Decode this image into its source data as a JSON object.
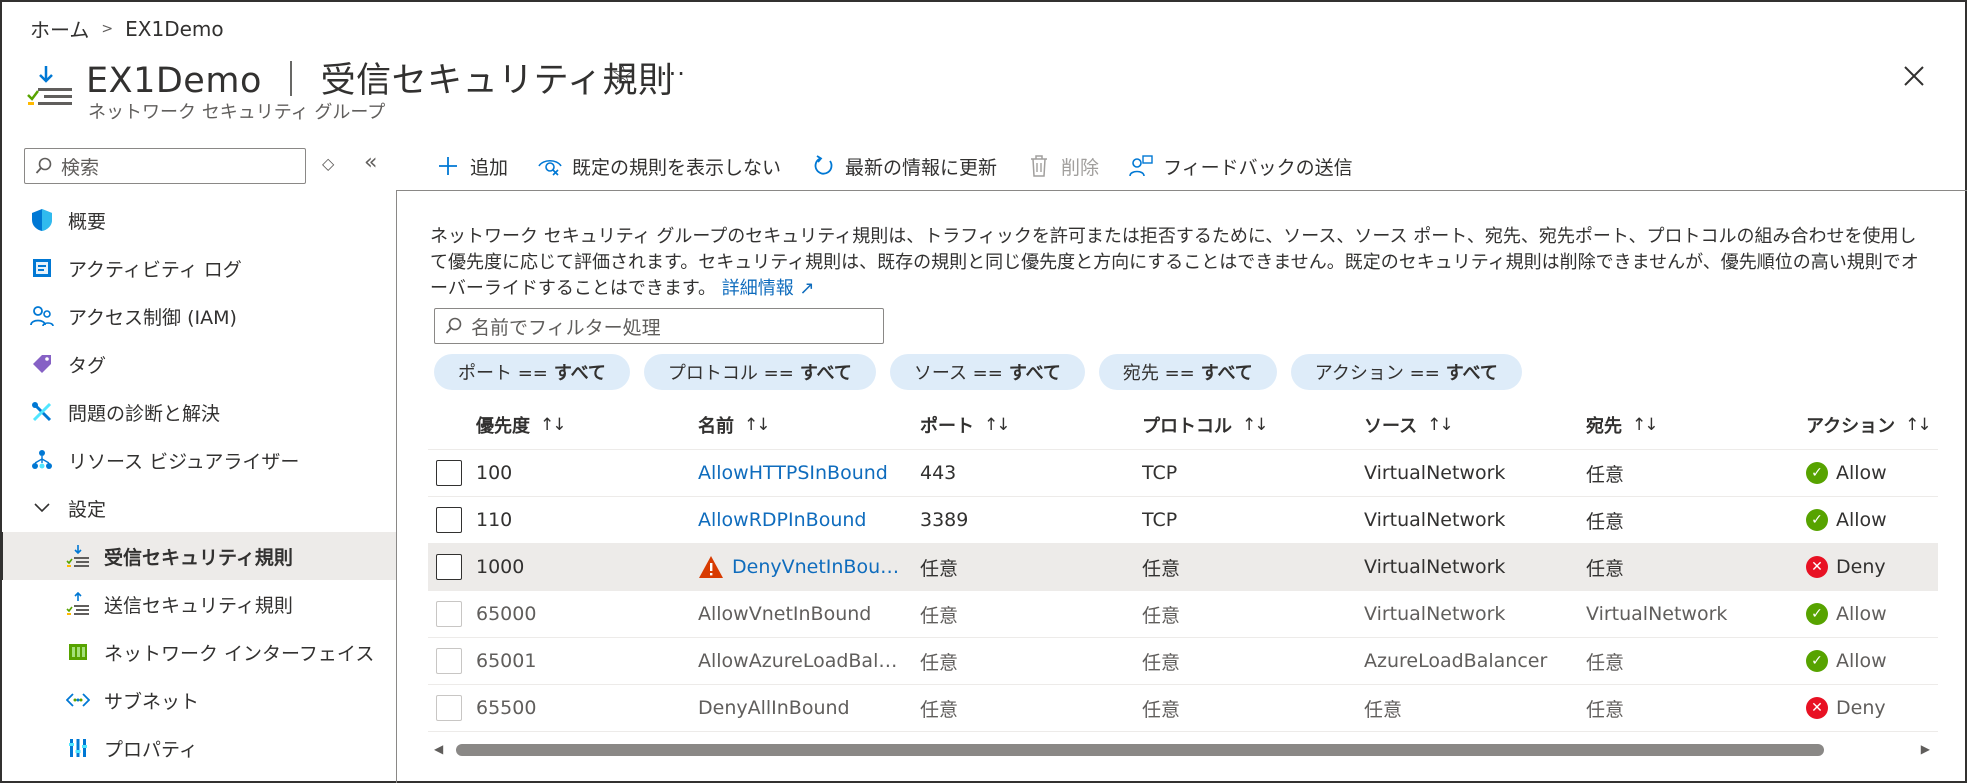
{
  "breadcrumb": {
    "home": "ホーム",
    "current": "EX1Demo"
  },
  "header": {
    "title": "EX1Demo ｜ 受信セキュリティ規則",
    "subtitle": "ネットワーク セキュリティ グループ",
    "icon": "inbound-rules-icon"
  },
  "sidebar": {
    "search_placeholder": "検索",
    "items": [
      {
        "label": "概要",
        "icon": "shield-icon"
      },
      {
        "label": "アクティビティ ログ",
        "icon": "activity-log-icon"
      },
      {
        "label": "アクセス制御 (IAM)",
        "icon": "iam-icon"
      },
      {
        "label": "タグ",
        "icon": "tag-icon"
      },
      {
        "label": "問題の診断と解決",
        "icon": "diagnose-icon"
      },
      {
        "label": "リソース ビジュアライザー",
        "icon": "visualizer-icon"
      },
      {
        "label": "設定",
        "icon": "chevron-down-icon"
      },
      {
        "label": "受信セキュリティ規則",
        "icon": "inbound-icon"
      },
      {
        "label": "送信セキュリティ規則",
        "icon": "outbound-icon"
      },
      {
        "label": "ネットワーク インターフェイス",
        "icon": "nic-icon"
      },
      {
        "label": "サブネット",
        "icon": "subnet-icon"
      },
      {
        "label": "プロパティ",
        "icon": "properties-icon"
      }
    ]
  },
  "toolbar": {
    "add": "追加",
    "hide_default": "既定の規則を表示しない",
    "refresh": "最新の情報に更新",
    "delete": "削除",
    "feedback": "フィードバックの送信"
  },
  "description": {
    "text": "ネットワーク セキュリティ グループのセキュリティ規則は、トラフィックを許可または拒否するために、ソース、ソース ポート、宛先、宛先ポート、プロトコルの組み合わせを使用して優先度に応じて評価されます。セキュリティ規則は、既存の規則と同じ優先度と方向にすることはできません。既定のセキュリティ規則は削除できませんが、優先順位の高い規則でオーバーライドすることはできます。",
    "link": "詳細情報"
  },
  "filter": {
    "placeholder": "名前でフィルター処理"
  },
  "pills": [
    {
      "label": "ポート ==",
      "value": "すべて"
    },
    {
      "label": "プロトコル ==",
      "value": "すべて"
    },
    {
      "label": "ソース ==",
      "value": "すべて"
    },
    {
      "label": "宛先 ==",
      "value": "すべて"
    },
    {
      "label": "アクション ==",
      "value": "すべて"
    }
  ],
  "table": {
    "columns": [
      "優先度",
      "名前",
      "ポート",
      "プロトコル",
      "ソース",
      "宛先",
      "アクション"
    ],
    "sort_glyph": "↑↓",
    "rows": [
      {
        "priority": "100",
        "name": "AllowHTTPSInBound",
        "port": "443",
        "protocol": "TCP",
        "source": "VirtualNetwork",
        "dest": "任意",
        "action": "Allow"
      },
      {
        "priority": "110",
        "name": "AllowRDPInBound",
        "port": "3389",
        "protocol": "TCP",
        "source": "VirtualNetwork",
        "dest": "任意",
        "action": "Allow"
      },
      {
        "priority": "1000",
        "name": "DenyVnetInBou…",
        "port": "任意",
        "protocol": "任意",
        "source": "VirtualNetwork",
        "dest": "任意",
        "action": "Deny"
      },
      {
        "priority": "65000",
        "name": "AllowVnetInBound",
        "port": "任意",
        "protocol": "任意",
        "source": "VirtualNetwork",
        "dest": "VirtualNetwork",
        "action": "Allow"
      },
      {
        "priority": "65001",
        "name": "AllowAzureLoadBal…",
        "port": "任意",
        "protocol": "任意",
        "source": "AzureLoadBalancer",
        "dest": "任意",
        "action": "Allow"
      },
      {
        "priority": "65500",
        "name": "DenyAllInBound",
        "port": "任意",
        "protocol": "任意",
        "source": "任意",
        "dest": "任意",
        "action": "Deny"
      }
    ]
  },
  "colors": {
    "link": "#0f6cbd",
    "allow": "#57a300",
    "deny": "#e81123",
    "warning": "#d83b01",
    "pill_bg": "#deecf9"
  }
}
